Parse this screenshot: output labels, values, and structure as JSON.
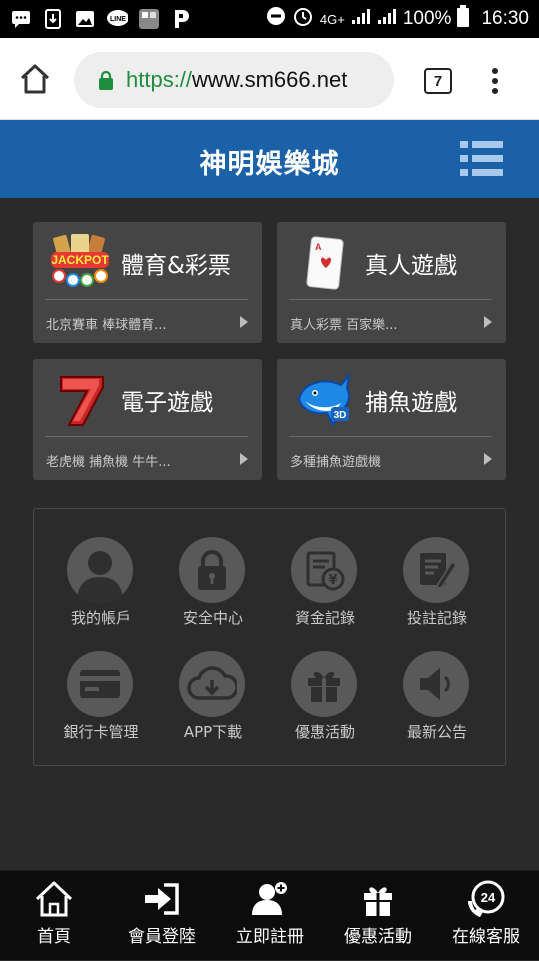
{
  "status_bar": {
    "notification_icons": [
      "message-icon",
      "download-icon",
      "image-icon",
      "line-icon",
      "app-icon",
      "p-icon"
    ],
    "signal_text": "4G+",
    "battery": "100%",
    "time": "16:30"
  },
  "browser": {
    "url_scheme": "https://",
    "url_host": "www.sm666.net",
    "tab_count": "7"
  },
  "site": {
    "title": "神明娛樂城"
  },
  "game_cards": [
    {
      "title": "體育&彩票",
      "subtitle": "北京賽車 棒球體育...",
      "icon": "jackpot-lottery-icon"
    },
    {
      "title": "真人遊戲",
      "subtitle": "真人彩票 百家樂...",
      "icon": "playing-card-icon"
    },
    {
      "title": "電子遊戲",
      "subtitle": "老虎機 捕魚機 牛牛...",
      "icon": "lucky-seven-icon"
    },
    {
      "title": "捕魚遊戲",
      "subtitle": "多種捕魚遊戲機",
      "icon": "shark-3d-icon"
    }
  ],
  "account_menu": [
    {
      "label": "我的帳戶",
      "icon": "user-icon"
    },
    {
      "label": "安全中心",
      "icon": "lock-icon"
    },
    {
      "label": "資金記錄",
      "icon": "funds-record-icon"
    },
    {
      "label": "投註記錄",
      "icon": "bet-record-icon"
    },
    {
      "label": "銀行卡管理",
      "icon": "bank-card-icon"
    },
    {
      "label": "APP下載",
      "icon": "cloud-download-icon"
    },
    {
      "label": "優惠活動",
      "icon": "gift-icon"
    },
    {
      "label": "最新公告",
      "icon": "speaker-icon"
    }
  ],
  "bottom_nav": [
    {
      "label": "首頁",
      "icon": "home-icon"
    },
    {
      "label": "會員登陸",
      "icon": "login-icon"
    },
    {
      "label": "立即註冊",
      "icon": "register-icon"
    },
    {
      "label": "優惠活動",
      "icon": "gift-icon"
    },
    {
      "label": "在線客服",
      "icon": "support-24-icon"
    }
  ],
  "colors": {
    "header_blue": "#1b61a8",
    "page_bg": "#2a2a2a",
    "card_bg": "#454545",
    "secure_green": "#1e8e3e"
  }
}
